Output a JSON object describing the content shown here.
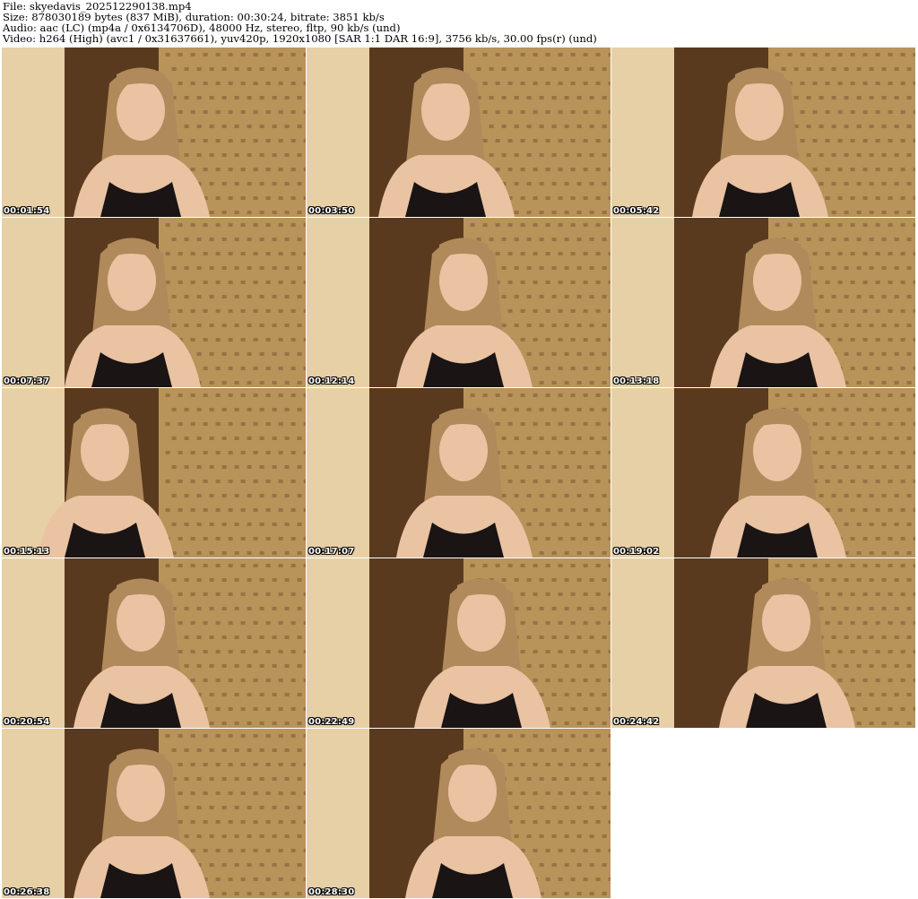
{
  "header": {
    "file_line": "File: skyedavis_202512290138.mp4",
    "size_line": "Size: 878030189 bytes (837 MiB), duration: 00:30:24, bitrate: 3851 kb/s",
    "audio_line": "Audio: aac (LC) (mp4a / 0x6134706D), 48000 Hz, stereo, fltp, 90 kb/s (und)",
    "video_line": "Video: h264 (High) (avc1 / 0x31637661), yuv420p, 1920x1080 [SAR 1:1 DAR 16:9], 3756 kb/s, 30.00 fps(r) (und)"
  },
  "thumbnails": [
    {
      "timestamp": "00:01:54"
    },
    {
      "timestamp": "00:03:50"
    },
    {
      "timestamp": "00:05:42"
    },
    {
      "timestamp": "00:07:37"
    },
    {
      "timestamp": "00:12:14"
    },
    {
      "timestamp": "00:13:18"
    },
    {
      "timestamp": "00:15:13"
    },
    {
      "timestamp": "00:17:07"
    },
    {
      "timestamp": "00:19:02"
    },
    {
      "timestamp": "00:20:54"
    },
    {
      "timestamp": "00:22:49"
    },
    {
      "timestamp": "00:24:42"
    },
    {
      "timestamp": "00:26:38"
    },
    {
      "timestamp": "00:28:30"
    }
  ],
  "colors": {
    "wall": "#e7d0a6",
    "door": "#5a3a1e",
    "curtain": "#b8935a",
    "curtain_dark": "#7a5a32",
    "hair": "#b08a5a",
    "skin": "#e9c3a2",
    "top": "#1a1414"
  }
}
